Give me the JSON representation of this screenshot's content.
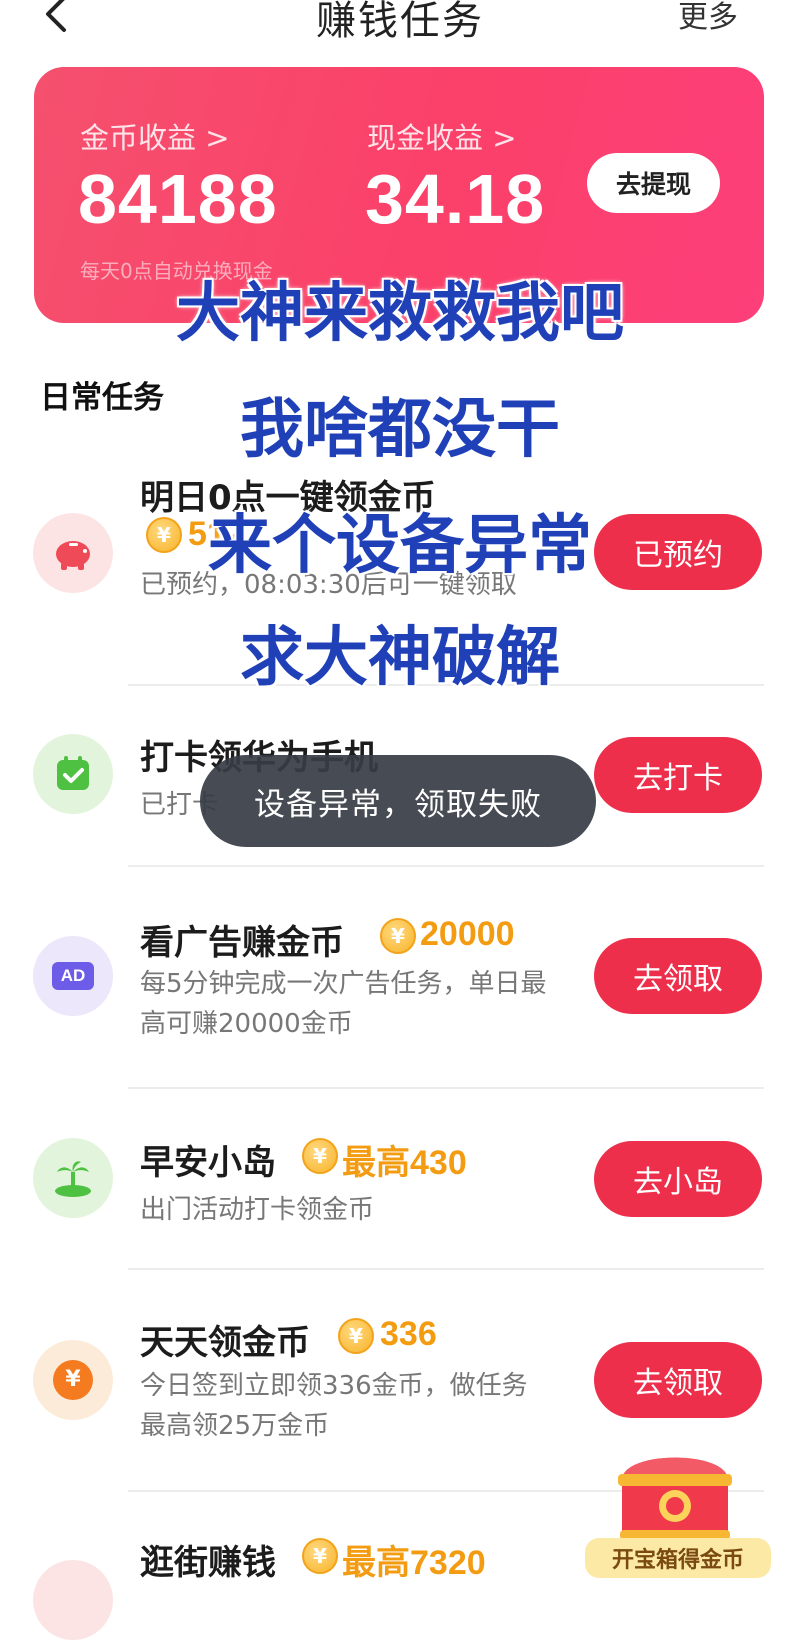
{
  "header": {
    "title": "赚钱任务",
    "more_label": "更多"
  },
  "earnings": {
    "coin_label": "金币收益 >",
    "coin_value": "84188",
    "cash_label": "现金收益 >",
    "cash_value": "34.18",
    "withdraw_label": "去提现",
    "note": "每天0点自动兑换现金"
  },
  "section_title": "日常任务",
  "tasks": [
    {
      "name": "明日0点一键领金币",
      "reward": "512",
      "desc": "已预约，08:03:30后可一键领取",
      "button": "已预约",
      "icon": "piggy-bank-icon",
      "icon_bg": "#fde4e4"
    },
    {
      "name": "打卡领华为手机",
      "reward": "",
      "desc": "已打卡",
      "button": "去打卡",
      "icon": "calendar-check-icon",
      "icon_bg": "#e2f5dc"
    },
    {
      "name": "看广告赚金币",
      "reward": "20000",
      "desc": "每5分钟完成一次广告任务，单日最高可赚20000金币",
      "button": "去领取",
      "icon": "ad-icon",
      "icon_bg": "#ece7fb"
    },
    {
      "name": "早安小岛",
      "reward": "最高430",
      "desc": "出门活动打卡领金币",
      "button": "去小岛",
      "icon": "island-icon",
      "icon_bg": "#e2f5dc"
    },
    {
      "name": "天天领金币",
      "reward": "336",
      "desc": "今日签到立即领336金币，做任务最高领25万金币",
      "button": "去领取",
      "icon": "yuan-coin-icon",
      "icon_bg": "#fdebd9"
    },
    {
      "name": "逛街赚钱",
      "reward": "最高7320",
      "desc": "",
      "button": "",
      "icon": "shopping-icon",
      "icon_bg": "#fde4e4"
    }
  ],
  "toast": "设备异常，领取失败",
  "overlay_lines": [
    "大神来救救我吧",
    "我啥都没干",
    "来个设备异常",
    "求大神破解"
  ],
  "chest_label": "开宝箱得金币",
  "colors": {
    "accent": "#ed2f4b",
    "card_gradient_start": "#f5506e",
    "card_gradient_end": "#fd3f7a",
    "reward": "#f39c12",
    "overlay_text": "#2040b8"
  }
}
